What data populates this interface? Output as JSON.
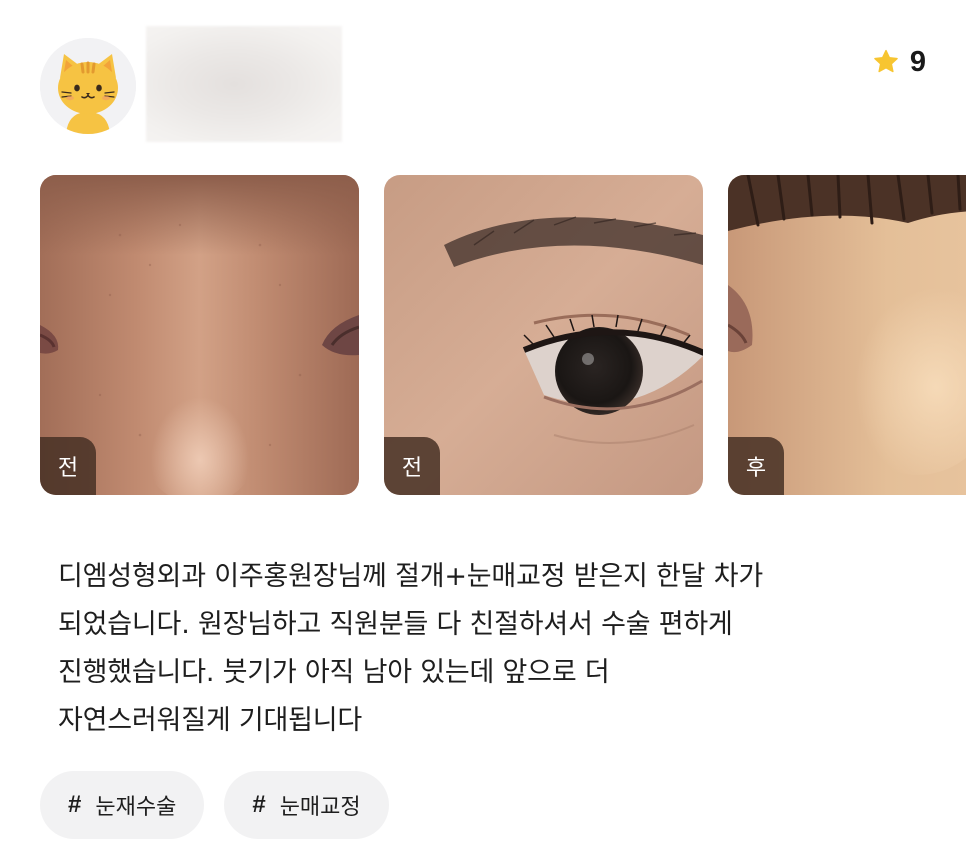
{
  "profile": {
    "avatar_icon": "cat-face-icon",
    "rating_icon": "star-icon",
    "rating": "9",
    "star_color": "#f7c531"
  },
  "photos": [
    {
      "tag": "전",
      "subject": "nose-bridge-close-up"
    },
    {
      "tag": "전",
      "subject": "eye-close-up"
    },
    {
      "tag": "후",
      "subject": "nose-bridge-close-up"
    }
  ],
  "review": {
    "lines": [
      "디엠성형외과 이주홍원장님께 절개+눈매교정 받은지 한달 차가",
      "되었습니다. 원장님하고 직원분들 다 친절하셔서 수술 편하게",
      "진행했습니다. 붓기가 아직 남아 있는데 앞으로 더",
      "자연스러워질게 기대됩니다"
    ]
  },
  "hashtags": [
    {
      "symbol": "#",
      "label": "눈재수술"
    },
    {
      "symbol": "#",
      "label": "눈매교정"
    }
  ]
}
